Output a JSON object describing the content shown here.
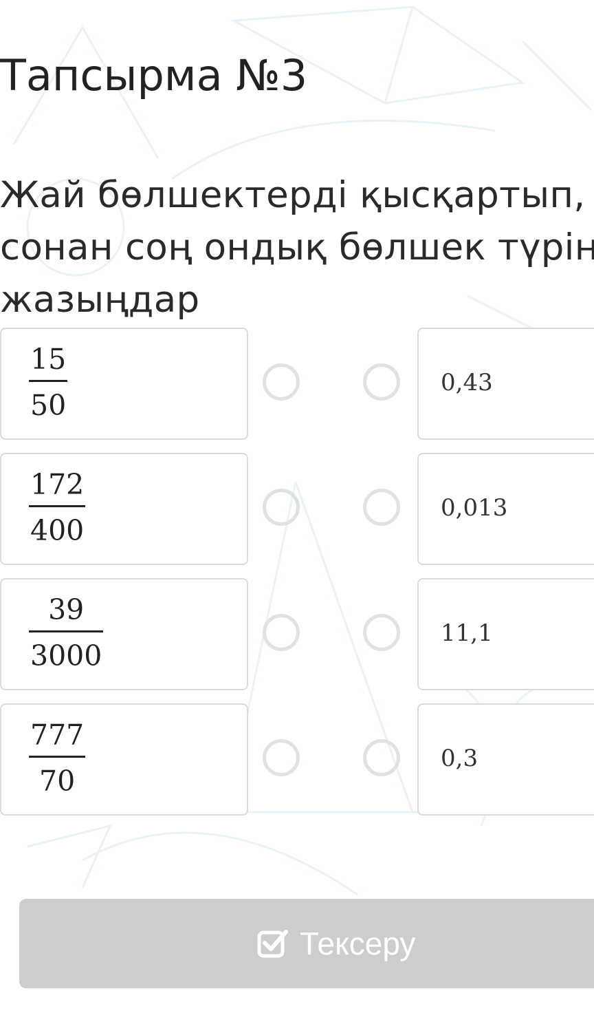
{
  "task": {
    "title": "Тапсырма №3",
    "question_lines": [
      "Жай бөлшектерді қысқартып,",
      "сонан соң ондық бөлшек түрін",
      "жазыңдар"
    ]
  },
  "fractions": [
    {
      "numerator": "15",
      "denominator": "50"
    },
    {
      "numerator": "172",
      "denominator": "400"
    },
    {
      "numerator": "39",
      "denominator": "3000"
    },
    {
      "numerator": "777",
      "denominator": "70"
    }
  ],
  "answers": [
    "0,43",
    "0,013",
    "11,1",
    "0,3"
  ],
  "check_button": {
    "label": "Тексеру",
    "icon": "check-square-icon"
  },
  "colors": {
    "card_border": "#d9dcdf",
    "dot_border": "#dfe2e5",
    "button_bg": "#cdcdcd",
    "button_text": "#ffffff"
  }
}
